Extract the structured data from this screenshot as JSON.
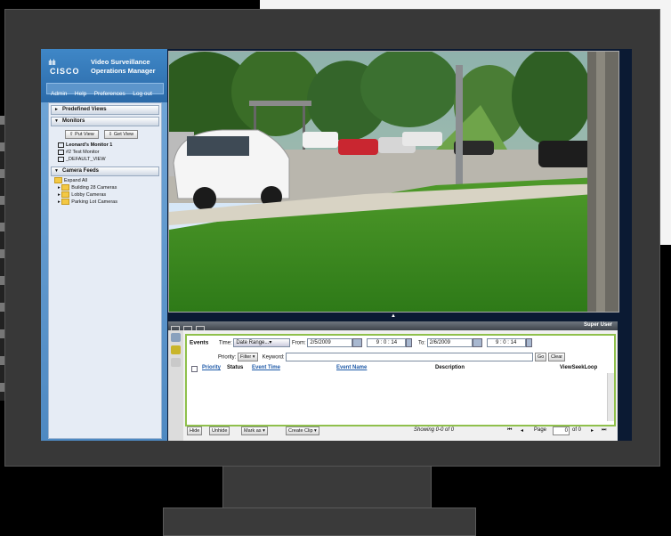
{
  "app": {
    "brand": "CISCO",
    "product_line1": "Video Surveillance",
    "product_line2": "Operations Manager"
  },
  "menu": [
    "Admin",
    "Help",
    "Preferences",
    "Log out"
  ],
  "sidebar": {
    "predefined_views": "Predefined Views",
    "monitors": "Monitors",
    "put_view": "Put View",
    "get_view": "Get View",
    "monitor_items": [
      "Leonard's Monitor 1",
      "#2 Test Monitor",
      "_DEFAULT_VIEW"
    ],
    "camera_feeds": "Camera Feeds",
    "expand_all": "Expand All",
    "camera_groups": [
      "Building 28 Cameras",
      "Lobby Cameras",
      "Parking Lot Cameras"
    ]
  },
  "statusbar": {
    "user": "Super User"
  },
  "events": {
    "title": "Events",
    "time_label": "Time:",
    "time_value": "Date Range...",
    "from_label": "From:",
    "from_date": "2/5/2009",
    "from_time": "9 : 0 : 14",
    "to_label": "To:",
    "to_date": "2/6/2009",
    "to_time": "9 : 0 : 14",
    "priority_label": "Priority:",
    "priority_value": "Filter",
    "keyword_label": "Keyword:",
    "keyword_value": "",
    "go": "Go",
    "clear": "Clear",
    "columns": {
      "priority": "Priority",
      "status": "Status",
      "event_time": "Event Time",
      "event_name": "Event Name",
      "description": "Description",
      "view_seek_loop": "ViewSeekLoop"
    },
    "hide": "Hide",
    "unhide": "Unhide",
    "mark_as": "Mark as",
    "create_clip": "Create Clip",
    "showing": "Showing 0-0 of 0",
    "page_label": "Page",
    "page_value": "0",
    "page_of": "of 0"
  }
}
